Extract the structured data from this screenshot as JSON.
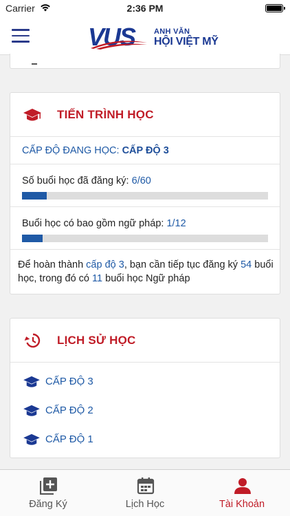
{
  "status_bar": {
    "carrier": "Carrier",
    "time": "2:36 PM"
  },
  "header": {
    "logo_main": "VUS",
    "logo_line1": "ANH VĂN",
    "logo_line2": "HỘI VIỆT MỸ"
  },
  "progress_card": {
    "title": "TIẾN TRÌNH HỌC",
    "level_label": "CẤP ĐỘ ĐANG HỌC:",
    "level_value": "CẤP ĐỘ 3",
    "sessions_label": "Số buổi học đã đăng ký:",
    "sessions_value": "6/60",
    "sessions_fraction": 0.1,
    "grammar_label": "Buổi học có bao gồm ngữ pháp:",
    "grammar_value": "1/12",
    "grammar_fraction": 0.083,
    "note_part1": "Để hoàn thành",
    "note_level": "cấp độ 3",
    "note_part2": ", bạn cần tiếp tục đăng ký",
    "note_sessions": "54",
    "note_part3": "buổi học, trong đó có",
    "note_grammar": "11",
    "note_part4": "buổi học Ngữ pháp"
  },
  "history_card": {
    "title": "LỊCH SỬ HỌC",
    "items": [
      {
        "label": "CẤP ĐỘ 3"
      },
      {
        "label": "CẤP ĐỘ 2"
      },
      {
        "label": "CẤP ĐỘ 1"
      }
    ]
  },
  "tabbar": {
    "tabs": [
      {
        "label": "Đăng Ký",
        "icon": "add-box-icon"
      },
      {
        "label": "Lịch Học",
        "icon": "calendar-icon"
      },
      {
        "label": "Tài Khoản",
        "icon": "user-icon",
        "active": true
      }
    ]
  },
  "colors": {
    "brand_blue": "#1b3993",
    "link_blue": "#1f5aa6",
    "accent_red": "#c01c27"
  }
}
